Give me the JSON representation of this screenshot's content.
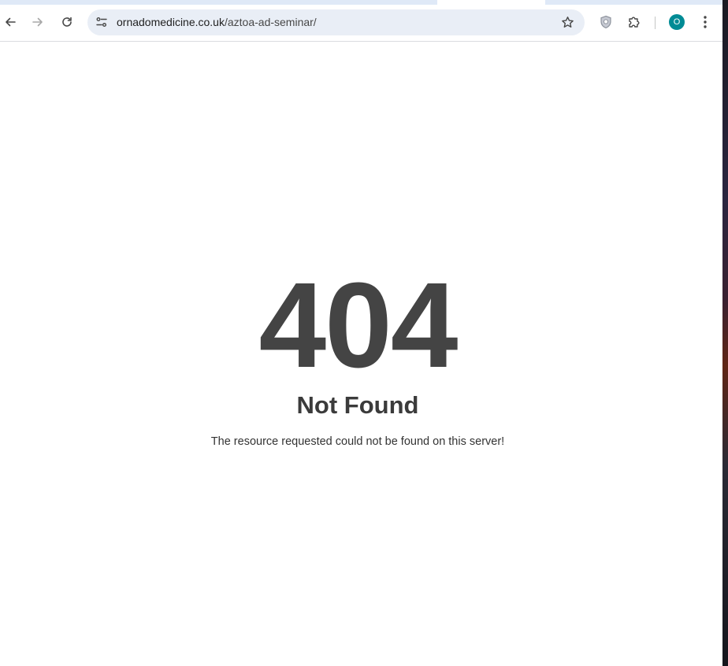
{
  "browser": {
    "url_domain": "ornadomedicine.co.uk",
    "url_path": "/aztoa-ad-seminar/",
    "profile_initial": "O",
    "colors": {
      "tabstrip": "#dfe9f7",
      "omnibox": "#e9eef6",
      "avatar": "#008b95"
    },
    "icons": [
      "back-arrow-icon",
      "forward-arrow-icon",
      "reload-icon",
      "site-settings-icon",
      "bookmark-star-icon",
      "shield-extension-icon",
      "extensions-puzzle-icon",
      "menu-dots-icon"
    ]
  },
  "page": {
    "error_code": "404",
    "error_title": "Not Found",
    "error_message": "The resource requested could not be found on this server!",
    "text_color": "#444444"
  }
}
